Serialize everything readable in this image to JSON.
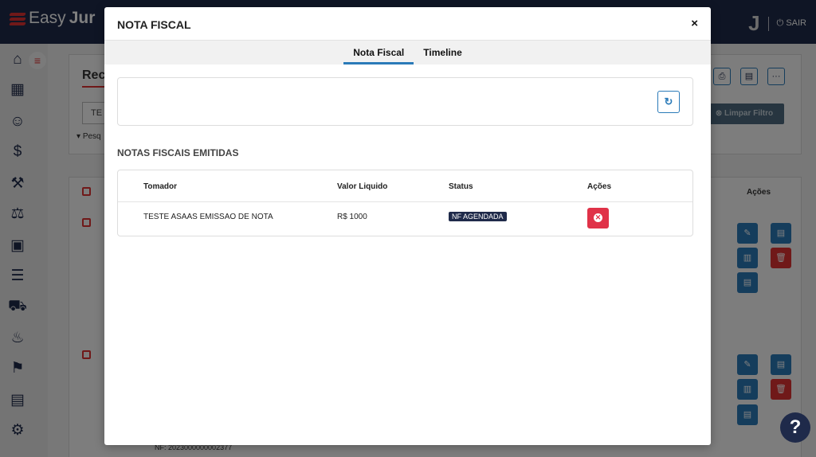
{
  "app": {
    "brand_light": "Easy",
    "brand_bold": "Jur",
    "avatar_letter": "J",
    "logout_label": "SAIR",
    "menu_toggle": "≡"
  },
  "background": {
    "page_title": "Rec",
    "filter_value": "TE",
    "search_toggle": "Pesq",
    "clear_filter_label": "Limpar Filtro",
    "actions_header": "Ações",
    "nf_text": "NF: 2023000000002377"
  },
  "modal": {
    "title": "NOTA FISCAL",
    "close": "×",
    "tabs": [
      {
        "label": "Nota Fiscal",
        "active": true
      },
      {
        "label": "Timeline",
        "active": false
      }
    ],
    "refresh_icon": "↻",
    "section_title": "NOTAS FISCAIS EMITIDAS",
    "table": {
      "headers": [
        "Tomador",
        "Valor Liquido",
        "Status",
        "Ações"
      ],
      "rows": [
        {
          "tomador": "TESTE ASAAS EMISSAO DE NOTA",
          "valor": "R$ 1000",
          "status": "NF AGENDADA",
          "action_icon": "✕"
        }
      ]
    }
  },
  "help_label": "?",
  "colors": {
    "navy": "#1f2a4a",
    "accent_blue": "#2a7ab8",
    "danger": "#e03248"
  }
}
